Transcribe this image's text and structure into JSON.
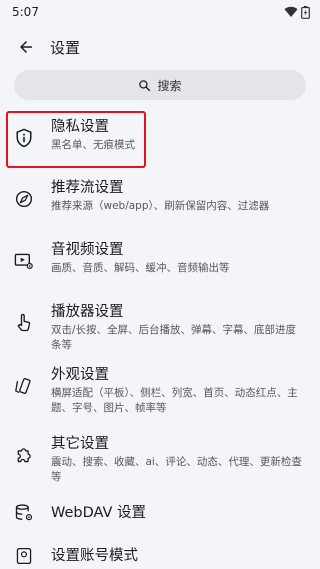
{
  "status_bar": {
    "time": "5:07"
  },
  "header": {
    "title": "设置"
  },
  "search": {
    "label": "搜索"
  },
  "items": [
    {
      "title": "隐私设置",
      "subtitle": "黑名单、无痕模式",
      "icon": "privacy-shield-icon"
    },
    {
      "title": "推荐流设置",
      "subtitle": "推荐来源（web/app）、刷新保留内容、过滤器",
      "icon": "compass-icon"
    },
    {
      "title": "音视频设置",
      "subtitle": "画质、音质、解码、缓冲、音频输出等",
      "icon": "video-settings-icon"
    },
    {
      "title": "播放器设置",
      "subtitle": "双击/长按、全屏、后台播放、弹幕、字幕、底部进度条等",
      "icon": "touch-icon"
    },
    {
      "title": "外观设置",
      "subtitle": "横屏适配（平板）、侧栏、列宽、首页、动态红点、主题、字号、图片、帧率等",
      "icon": "appearance-icon"
    },
    {
      "title": "其它设置",
      "subtitle": "震动、搜索、收藏、ai、评论、动态、代理、更新检查等",
      "icon": "puzzle-icon"
    },
    {
      "title": "WebDAV 设置",
      "subtitle": "",
      "icon": "database-settings-icon"
    },
    {
      "title": "设置账号模式",
      "subtitle": "",
      "icon": "account-icon"
    }
  ],
  "colors": {
    "highlight": "#e0141e",
    "background": "#f4f5f9",
    "search_bg": "#e4e5ea"
  }
}
